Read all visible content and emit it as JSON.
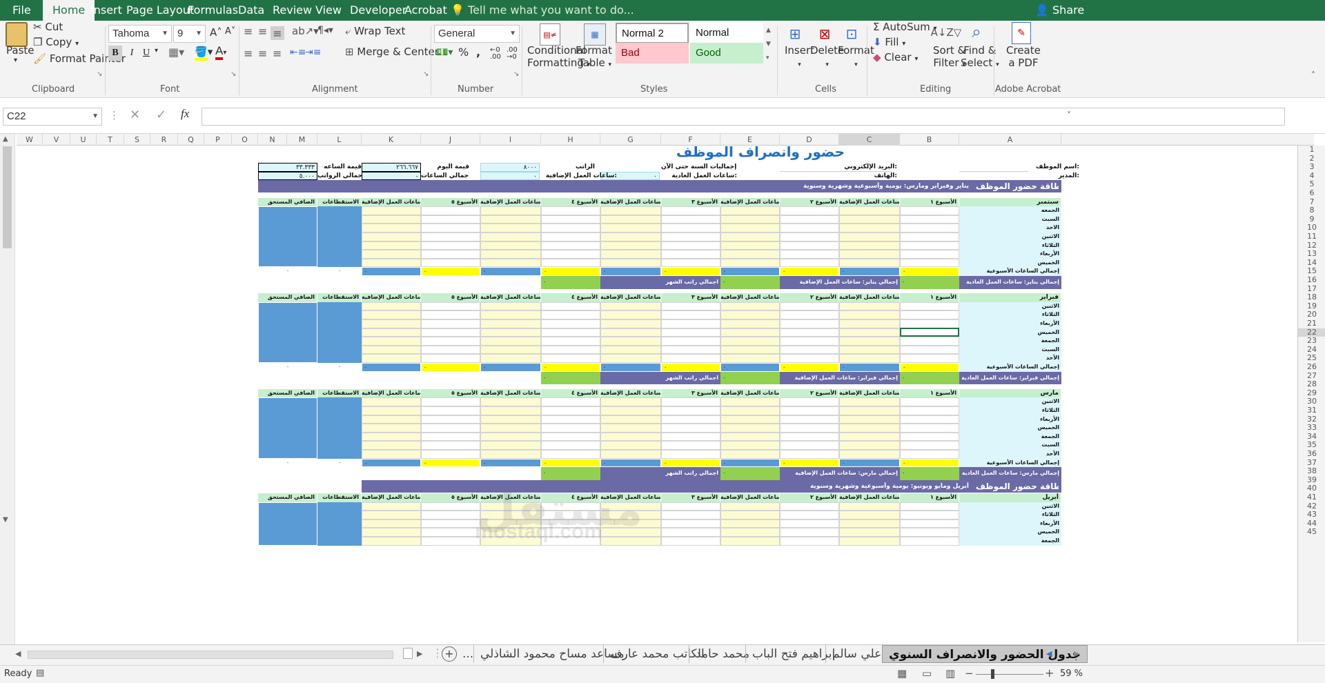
{
  "menu": {
    "tabs": [
      "File",
      "Home",
      "Insert",
      "Page Layout",
      "Formulas",
      "Data",
      "Review",
      "View",
      "Developer",
      "Acrobat"
    ],
    "tell_me": "Tell me what you want to do...",
    "share": "Share"
  },
  "ribbon": {
    "clipboard": {
      "paste": "Paste",
      "cut": "Cut",
      "copy": "Copy",
      "format_painter": "Format Painter",
      "group": "Clipboard"
    },
    "font": {
      "name": "Tahoma",
      "size": "9",
      "group": "Font",
      "bold": "B",
      "italic": "I",
      "underline": "U"
    },
    "alignment": {
      "wrap_text": "Wrap Text",
      "merge_center": "Merge & Center",
      "group": "Alignment"
    },
    "number": {
      "format": "General",
      "percent": "%",
      "comma": ",",
      "group": "Number"
    },
    "styles": {
      "conditional": "Conditional",
      "formatting": "Formatting",
      "format_as": "Format as",
      "table": "Table",
      "normal2": "Normal 2",
      "normal": "Normal",
      "bad": "Bad",
      "good": "Good",
      "group": "Styles"
    },
    "cells": {
      "insert": "Insert",
      "delete": "Delete",
      "format": "Format",
      "group": "Cells"
    },
    "editing": {
      "autosum": "AutoSum",
      "fill": "Fill",
      "clear": "Clear",
      "sort": "Sort &",
      "filter": "Filter",
      "find": "Find &",
      "select": "Select",
      "group": "Editing"
    },
    "acrobat": {
      "create": "Create",
      "pdf": "a PDF",
      "group": "Adobe Acrobat"
    }
  },
  "formula_bar": {
    "name_box": "C22",
    "fx": "fx",
    "value": ""
  },
  "columns": [
    "W",
    "V",
    "U",
    "T",
    "S",
    "R",
    "Q",
    "P",
    "O",
    "N",
    "M",
    "L",
    "K",
    "J",
    "I",
    "H",
    "G",
    "F",
    "E",
    "D",
    "C",
    "B",
    "A"
  ],
  "rows": [
    "1",
    "2",
    "3",
    "4",
    "5",
    "6",
    "7",
    "8",
    "9",
    "10",
    "11",
    "12",
    "13",
    "14",
    "15",
    "16",
    "17",
    "18",
    "19",
    "20",
    "21",
    "22",
    "23",
    "24",
    "25",
    "26",
    "27",
    "28",
    "29",
    "30",
    "31",
    "32",
    "33",
    "34",
    "35",
    "36",
    "37",
    "38",
    "39",
    "40",
    "41",
    "42",
    "43",
    "44",
    "45"
  ],
  "sheet": {
    "title": "حضور وانصراف الموظف",
    "info": {
      "employee_name": "اسم الموظف:",
      "manager": "المدير:",
      "email": "البريد الإلكتروني:",
      "phone": "الهاتف:",
      "year_totals": "إجماليات السنة حتى الآن:",
      "regular_hours": "ساعات العمل العادية:",
      "salary": "الراتب",
      "salary_value": "٨٠٠٠",
      "overtime_hours": "ساعات العمل الإضافية:",
      "zero": "٠",
      "day_value": "قيمة اليوم",
      "day_value_num": "٢٦٦.٦٦٧",
      "total_hours": "اجمالي الساعات",
      "dash": "-",
      "hour_value": "قيمة الساعه",
      "hour_value_num": "٣٣.٣٣٣",
      "total_salaries": "اجمالي الرواتب",
      "total_salaries_num": "٥.٠٠٠"
    },
    "banner1_title": "بطاقة حضور الموظف",
    "banner1_sub": "يناير وفبراير ومارس: يومية وأسبوعية وشهرية وسنوية",
    "banner2_title": "بطاقة حضور الموظف",
    "banner2_sub": "أبريل ومايو ويونيو: يومية وأسبوعية وشهرية وسنوية",
    "headers": [
      "الأسبوع ١",
      "ساعات العمل الإضافية",
      "الأسبوع ٢",
      "ساعات العمل الإضافية",
      "الأسبوع ٣",
      "ساعات العمل الإضافية",
      "الأسبوع ٤",
      "ساعات العمل الإضافية",
      "الأسبوع ٥",
      "ساعات العمل الإضافية",
      "الاستقطاعات",
      "الصافي المستحق"
    ],
    "months": [
      {
        "name": "سبتمبر",
        "days": [
          "الجمعه",
          "السبت",
          "الاحد",
          "الاثنين",
          "الثلاثاء",
          "الأربعاء",
          "الخميس"
        ],
        "total_regular": "إجمالي يناير: ساعات العمل العادية",
        "total_overtime": "إجمالي يناير: ساعات العمل الإضافية"
      },
      {
        "name": "فبراير",
        "days": [
          "الاثنين",
          "الثلاثاء",
          "الأربعاء",
          "الخميس",
          "الجمعة",
          "السبت",
          "الأحد"
        ],
        "total_regular": "إجمالي فبراير: ساعات العمل العادية",
        "total_overtime": "إجمالي فبراير: ساعات العمل الإضافية"
      },
      {
        "name": "مارس",
        "days": [
          "الاثنين",
          "الثلاثاء",
          "الأربعاء",
          "الخميس",
          "الجمعة",
          "السبت",
          "الأحد"
        ],
        "total_regular": "إجمالي مارس: ساعات العمل العادية",
        "total_overtime": "إجمالي مارس: ساعات العمل الإضافية"
      },
      {
        "name": "أبريل",
        "days": [
          "الاثنين",
          "الثلاثاء",
          "الأربعاء",
          "الخميس",
          "الجمعة"
        ],
        "total_regular": "",
        "total_overtime": ""
      }
    ],
    "weekly_total": "إجمالي الساعات الأسبوعية",
    "month_salary": "اجمالي راتب الشهر",
    "zero": "٠"
  },
  "sheet_tabs": [
    "جدول الحضور والانصراف السنوي",
    "علي سالم",
    "ابراهيم فتح الباب",
    "محمد حامد",
    "الكاتب محمد عارف",
    "مساعد مساح محمود الشاذلي",
    "..."
  ],
  "status": {
    "ready": "Ready",
    "zoom": "59 %",
    "plus": "+",
    "minus": "−"
  },
  "watermark": {
    "arabic": "مستقل",
    "latin": "mostaql.com"
  },
  "colors": {
    "excel_green": "#217346",
    "light_green": "#c6efce",
    "light_yellow": "#fdfbd2",
    "blue": "#5b9bd5",
    "yellow": "#ffff00",
    "green": "#92d050",
    "purple": "#6a6aa6",
    "cyan": "#dcf6fb"
  }
}
